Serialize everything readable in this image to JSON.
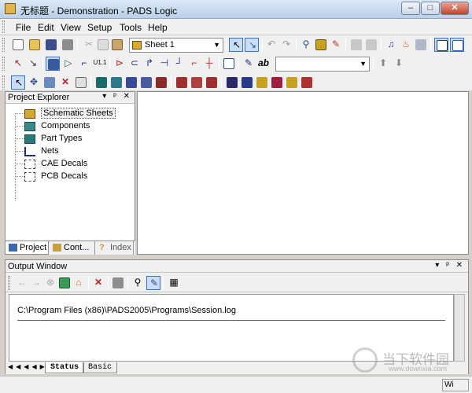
{
  "window": {
    "title": "无标题 - Demonstration - PADS Logic",
    "buttons": {
      "minimize": "–",
      "maximize": "□",
      "close": "✕"
    }
  },
  "menu": {
    "items": [
      {
        "label": "File",
        "accel": "F"
      },
      {
        "label": "Edit",
        "accel": "E"
      },
      {
        "label": "View",
        "accel": "V"
      },
      {
        "label": "Setup",
        "accel": "S"
      },
      {
        "label": "Tools",
        "accel": "T"
      },
      {
        "label": "Help",
        "accel": "H"
      }
    ]
  },
  "toolbar": {
    "sheet_select": {
      "value": "Sheet 1"
    },
    "layer_select": {
      "value": ""
    }
  },
  "project_explorer": {
    "title": "Project Explorer",
    "header_buttons": "▾ ᵖ ✕",
    "items": [
      {
        "label": "Schematic Sheets",
        "icon": "schematic-sheets-icon"
      },
      {
        "label": "Components",
        "icon": "components-icon"
      },
      {
        "label": "Part Types",
        "icon": "part-types-icon"
      },
      {
        "label": "Nets",
        "icon": "nets-icon"
      },
      {
        "label": "CAE Decals",
        "icon": "cae-decals-icon"
      },
      {
        "label": "PCB Decals",
        "icon": "pcb-decals-icon"
      }
    ],
    "tabs": [
      {
        "label": "Project"
      },
      {
        "label": "Cont..."
      },
      {
        "label": "Index"
      }
    ]
  },
  "output_window": {
    "title": "Output Window",
    "header_buttons": "▾ ᵖ ✕",
    "log_line": "C:\\Program Files (x86)\\PADS2005\\Programs\\Session.log",
    "tabs": [
      {
        "label": "Status"
      },
      {
        "label": "Basic"
      }
    ],
    "nav_arrows": "◀◀◀◀▶▶"
  },
  "status_bar": {
    "cell": "Wi"
  },
  "watermark": {
    "text": "当下软件园",
    "url": "www.downxia.com"
  },
  "colors": {
    "titlebar": "#b9d1ea",
    "chrome": "#f0f0f0",
    "pane_border": "#8b8b8b",
    "selection_outline": "#3a70c2"
  }
}
